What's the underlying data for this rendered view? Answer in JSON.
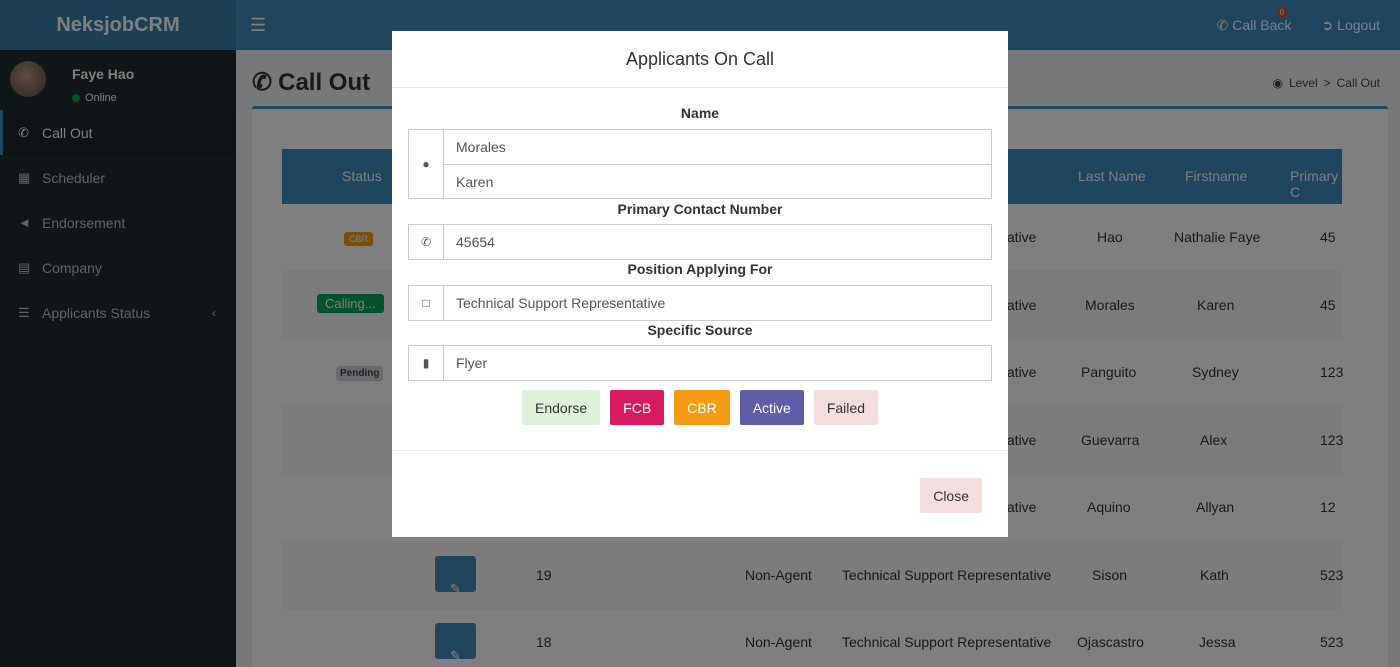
{
  "app": {
    "logo": "NeksjobCRM"
  },
  "header": {
    "menu_toggle_icon": "bars-icon",
    "callback_label": "Call Back",
    "callback_count": "0",
    "logout_label": "Logout"
  },
  "sidebar": {
    "user_name": "Faye Hao",
    "user_status": "Online",
    "items": [
      {
        "label": "Call Out",
        "icon": "phone-icon"
      },
      {
        "label": "Scheduler",
        "icon": "calendar-icon"
      },
      {
        "label": "Endorsement",
        "icon": "bullhorn-icon"
      },
      {
        "label": "Company",
        "icon": "building-icon"
      },
      {
        "label": "Applicants Status",
        "icon": "list-icon"
      }
    ]
  },
  "page": {
    "title": "Call Out",
    "breadcrumb": [
      "Level",
      "Call Out"
    ]
  },
  "table": {
    "headers": [
      "Status",
      "Last Name",
      "Firstname",
      "Primary C"
    ],
    "rows": [
      {
        "status": "CBR",
        "tail": "tative",
        "last": "Hao",
        "first": "Nathalie Faye",
        "primary": "45"
      },
      {
        "status": "Calling...",
        "tail": "tative",
        "last": "Morales",
        "first": "Karen",
        "primary": "45"
      },
      {
        "status": "Pending",
        "tail": "tative",
        "last": "Panguito",
        "first": "Sydney",
        "primary": "123"
      },
      {
        "status": "",
        "tail": "tative",
        "last": "Guevarra",
        "first": "Alex",
        "primary": "123"
      },
      {
        "status": "",
        "tail": "tative",
        "last": "Aquino",
        "first": "Allyan",
        "primary": "12"
      },
      {
        "status": "",
        "id": "19",
        "type": "Non-Agent",
        "position": "Technical Support Representative",
        "last": "Sison",
        "first": "Kath",
        "primary": "523"
      },
      {
        "status": "",
        "id": "18",
        "type": "Non-Agent",
        "position": "Technical Support Representative",
        "last": "Ojascastro",
        "first": "Jessa",
        "primary": "523"
      }
    ]
  },
  "modal": {
    "title": "Applicants On Call",
    "name_label": "Name",
    "last_name": "Morales",
    "first_name": "Karen",
    "contact_label": "Primary Contact Number",
    "contact": "45654",
    "position_label": "Position Applying For",
    "position": "Technical Support Representative",
    "source_label": "Specific Source",
    "source": "Flyer",
    "buttons": {
      "endorse": "Endorse",
      "fcb": "FCB",
      "cbr": "CBR",
      "active": "Active",
      "failed": "Failed"
    },
    "close": "Close"
  }
}
